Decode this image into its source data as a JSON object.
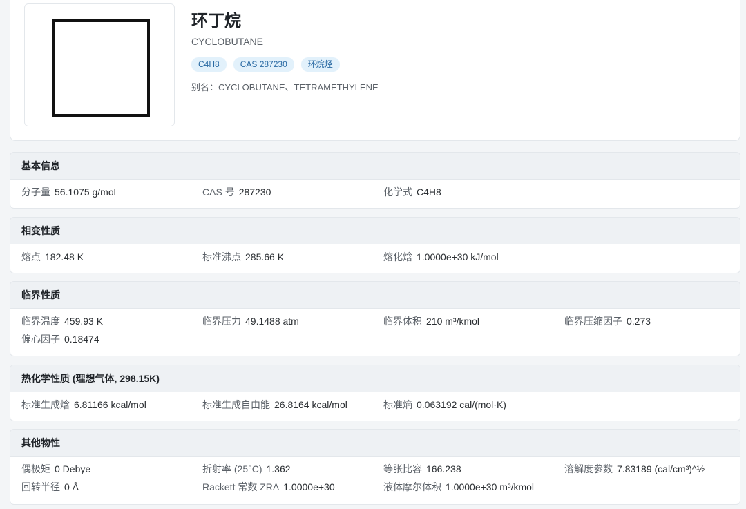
{
  "compound": {
    "name_cn": "环丁烷",
    "name_en": "CYCLOBUTANE",
    "tags": [
      "C4H8",
      "CAS 287230",
      "环烷烃"
    ],
    "aliases": "别名：CYCLOBUTANE、TETRAMETHYLENE"
  },
  "sections": {
    "basic": {
      "title": "基本信息",
      "props": [
        {
          "k": "分子量",
          "v": "56.1075 g/mol"
        },
        {
          "k": "CAS 号",
          "v": "287230"
        },
        {
          "k": "化学式",
          "v": "C4H8"
        }
      ]
    },
    "phase": {
      "title": "相变性质",
      "props": [
        {
          "k": "熔点",
          "v": "182.48 K"
        },
        {
          "k": "标准沸点",
          "v": "285.66 K"
        },
        {
          "k": "熔化焓",
          "v": "1.0000e+30 kJ/mol"
        }
      ]
    },
    "critical": {
      "title": "临界性质",
      "props": [
        {
          "k": "临界温度",
          "v": "459.93 K"
        },
        {
          "k": "临界压力",
          "v": "49.1488 atm"
        },
        {
          "k": "临界体积",
          "v": "210 m³/kmol"
        },
        {
          "k": "临界压缩因子",
          "v": "0.273"
        },
        {
          "k": "偏心因子",
          "v": "0.18474"
        }
      ]
    },
    "thermo": {
      "title": "热化学性质 (理想气体, 298.15K)",
      "props": [
        {
          "k": "标准生成焓",
          "v": "6.81166 kcal/mol"
        },
        {
          "k": "标准生成自由能",
          "v": "26.8164 kcal/mol"
        },
        {
          "k": "标准熵",
          "v": "0.063192 cal/(mol·K)"
        }
      ]
    },
    "other": {
      "title": "其他物性",
      "props": [
        {
          "k": "偶极矩",
          "v": "0 Debye"
        },
        {
          "k": "折射率 (25°C)",
          "v": "1.362"
        },
        {
          "k": "等张比容",
          "v": "166.238"
        },
        {
          "k": "溶解度参数",
          "v": "7.83189 (cal/cm³)^½"
        },
        {
          "k": "回转半径",
          "v": "0 Å"
        },
        {
          "k": "Rackett 常数 ZRA",
          "v": "1.0000e+30"
        },
        {
          "k": "液体摩尔体积",
          "v": "1.0000e+30 m³/kmol"
        }
      ]
    }
  }
}
